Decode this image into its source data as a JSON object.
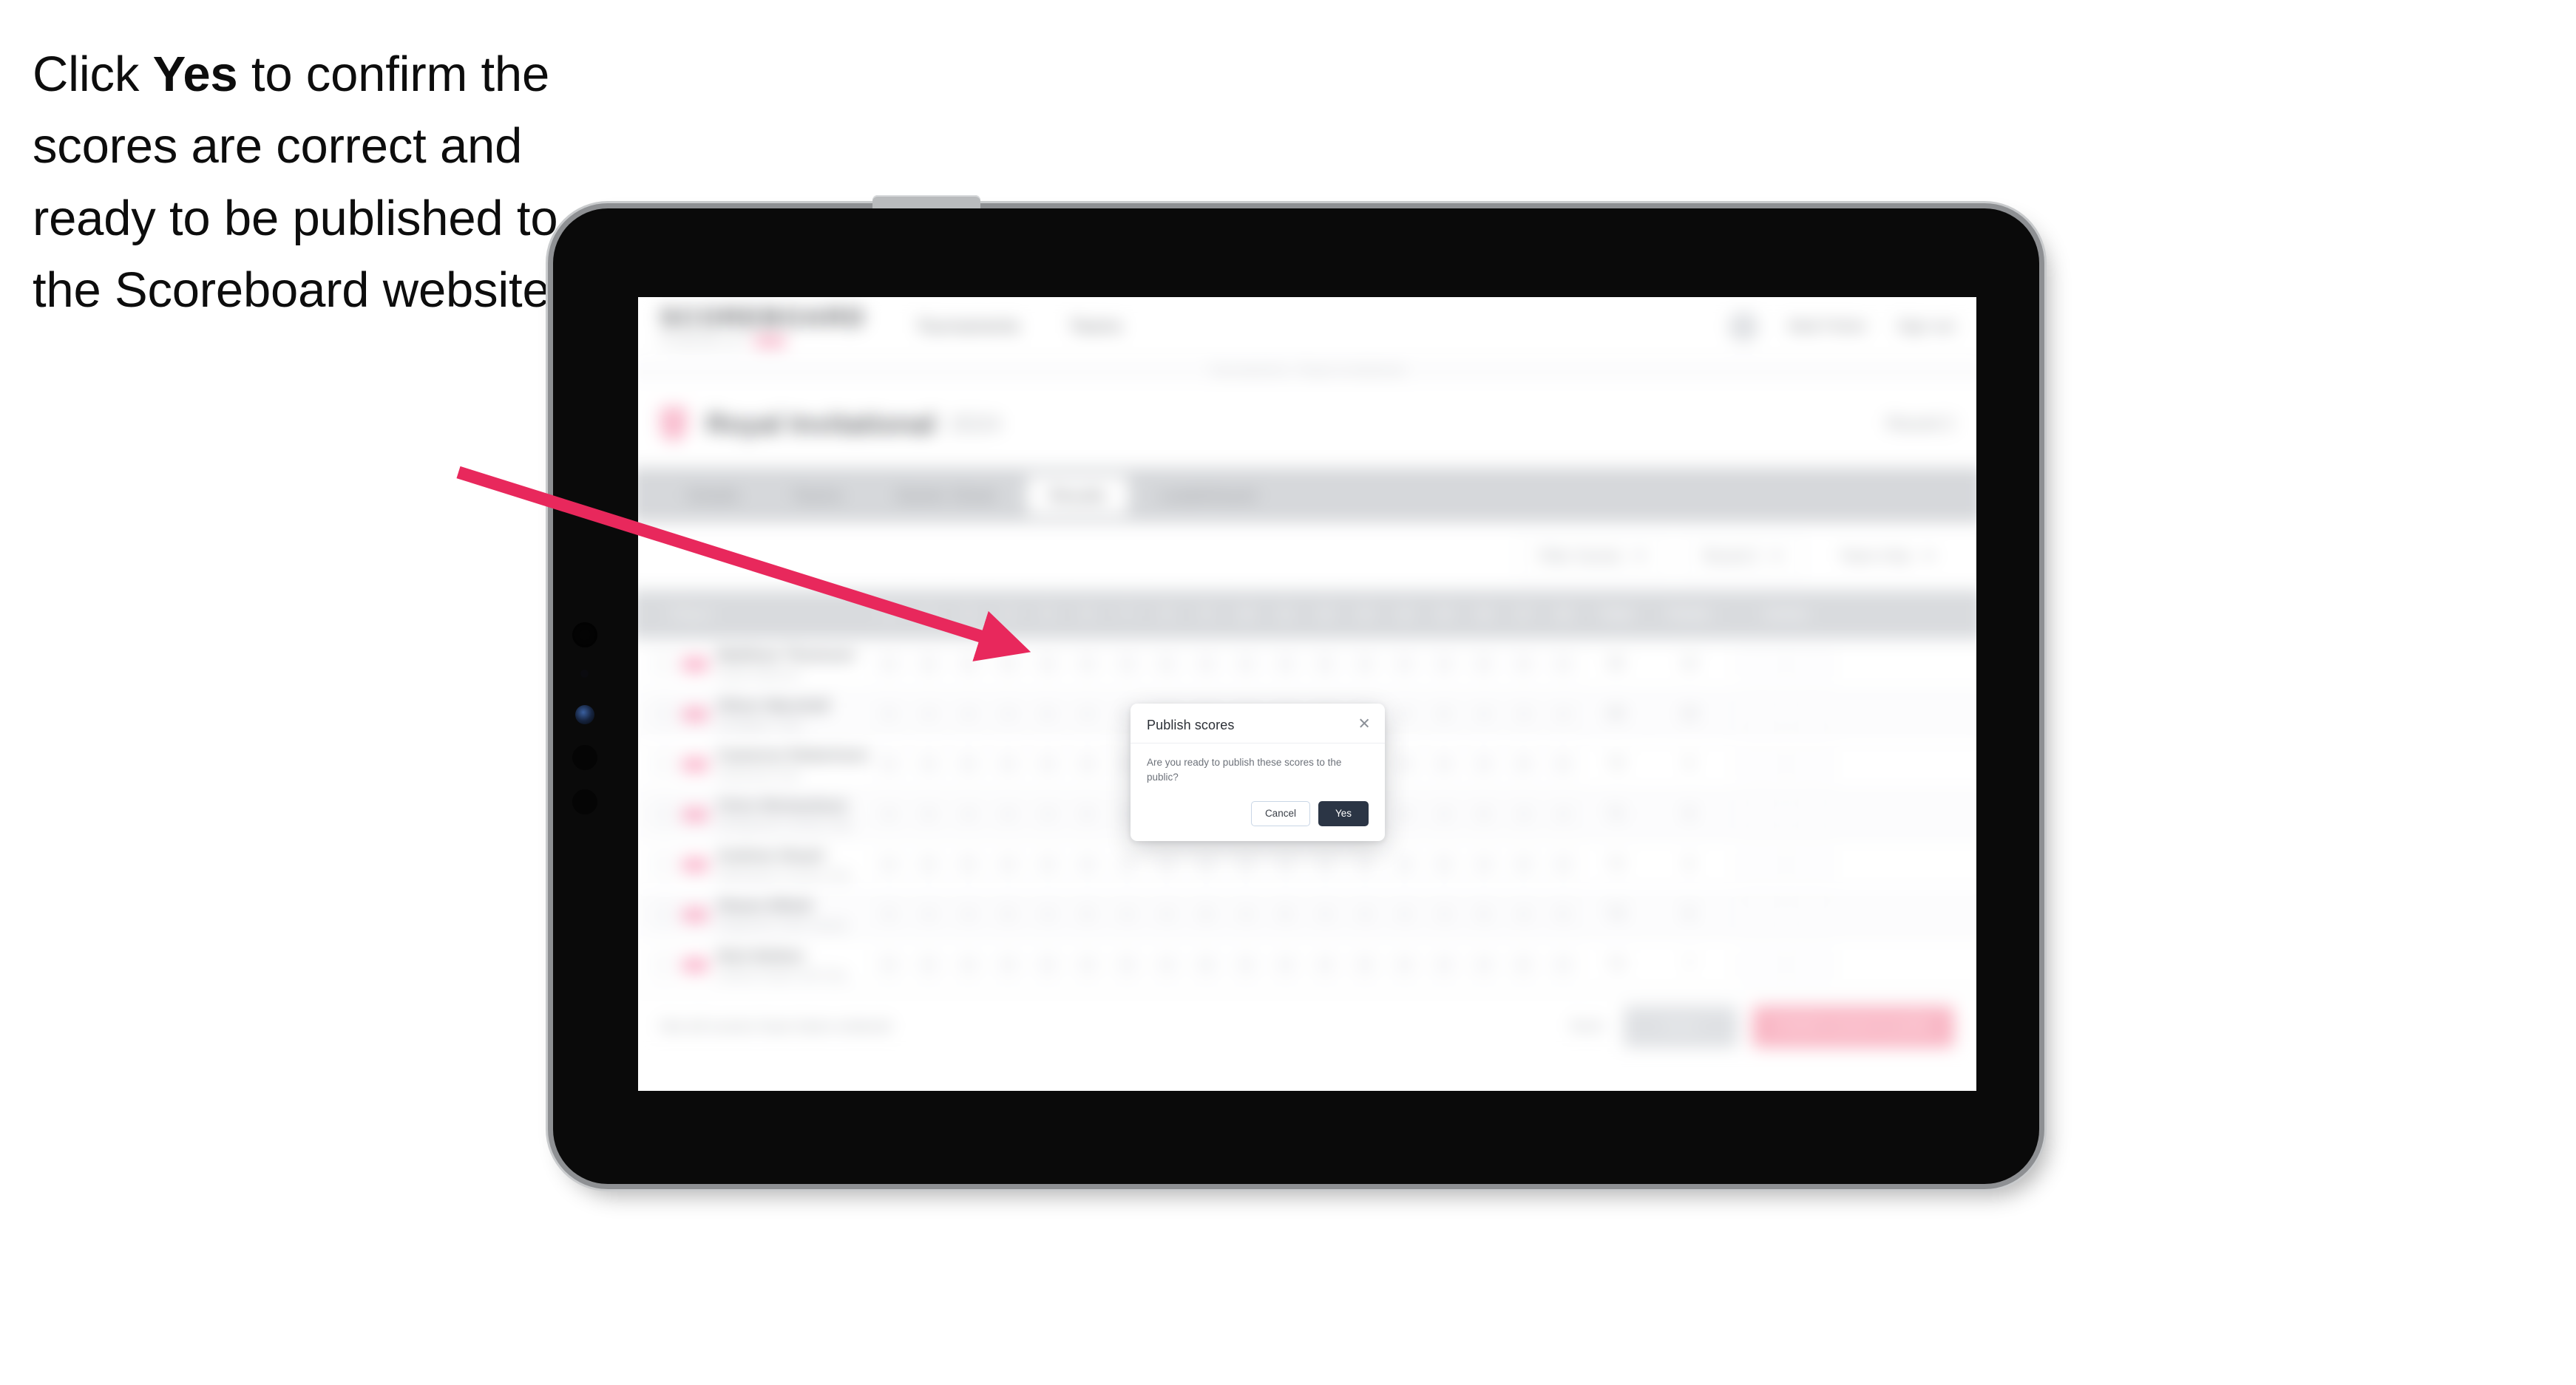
{
  "caption": {
    "before": "Click ",
    "bold": "Yes",
    "after": " to confirm the scores are correct and ready to be published to the Scoreboard website."
  },
  "colors": {
    "arrow": "#e8285c",
    "accent_pink": "#f9a7c2",
    "yes_button": "#2b3545",
    "tabbar": "#d6d8db",
    "table_header": "#d9dbde"
  },
  "device": {
    "type": "tablet",
    "orientation": "landscape"
  },
  "app": {
    "brand": {
      "name": "SCOREBOARD",
      "tagline": "POWERED BY"
    },
    "topnav": [
      {
        "label": "Tournaments"
      },
      {
        "label": "Teams"
      }
    ],
    "topbar_right": [
      {
        "label": "Matt Fisher"
      },
      {
        "label": "Sign out"
      }
    ],
    "breadcrumb": "Tournaments / Royal Invitational",
    "page_title": {
      "main": "Royal Invitational",
      "sub": "2024",
      "right": "Round 2"
    },
    "tabs": [
      {
        "label": "Details",
        "active": false
      },
      {
        "label": "Teams",
        "active": false
      },
      {
        "label": "Starter Sheet",
        "active": false
      },
      {
        "label": "Results",
        "active": true
      },
      {
        "label": "Leaderboard",
        "active": false
      }
    ],
    "toolbar": {
      "filters": [
        {
          "label": "Filter Scores"
        },
        {
          "label": "Round 2"
        },
        {
          "label": "Team Only"
        }
      ]
    },
    "table": {
      "headers": {
        "player": "Player",
        "holes": [
          "1",
          "2",
          "3",
          "4",
          "5",
          "6",
          "7",
          "8",
          "9",
          "10",
          "11",
          "12",
          "13",
          "14",
          "15",
          "16",
          "17",
          "18"
        ],
        "total": "Total",
        "points": "Points",
        "action": "Action"
      },
      "rows": [
        {
          "name": "Matthew Thomson",
          "club": "Royal Oakmont",
          "scores": [
            "4",
            "5",
            "3",
            "4",
            "5",
            "4",
            "3",
            "5",
            "4",
            "4",
            "3",
            "5",
            "4",
            "4",
            "3",
            "5",
            "4",
            "4"
          ],
          "total": "68",
          "points": "10",
          "actions": [
            "Edit",
            "View"
          ]
        },
        {
          "name": "Oliver Marshall",
          "club": "Sandpiper Links",
          "scores": [
            "5",
            "4",
            "4",
            "3",
            "5",
            "4",
            "4",
            "5",
            "3",
            "4",
            "4",
            "5",
            "3",
            "4",
            "5",
            "4",
            "3",
            "4"
          ],
          "total": "69",
          "points": "10",
          "actions": [
            "Edit",
            "View"
          ]
        },
        {
          "name": "Cameron Robertson",
          "club": "Glenbrook Park",
          "scores": [
            "4",
            "4",
            "5",
            "4",
            "4",
            "3",
            "5",
            "4",
            "4",
            "5",
            "4",
            "4",
            "3",
            "5",
            "4",
            "3",
            "4",
            "5"
          ],
          "total": "70",
          "points": "9",
          "actions": [
            "Edit",
            "View"
          ]
        },
        {
          "name": "Chris Richardson",
          "club": "Northpointe Country Club",
          "scores": [
            "5",
            "5",
            "4",
            "4",
            "3",
            "5",
            "4",
            "4",
            "6",
            "4",
            "3",
            "4",
            "5",
            "4",
            "4",
            "5",
            "3",
            "4"
          ],
          "total": "71",
          "points": "9",
          "actions": [
            "Edit",
            "View"
          ]
        },
        {
          "name": "Andrew Stuart",
          "club": "Willowbank Country Club",
          "scores": [
            "4",
            "5",
            "5",
            "4",
            "4",
            "4",
            "3",
            "5",
            "6",
            "5",
            "4",
            "4",
            "4",
            "3",
            "5",
            "4",
            "4",
            "4"
          ],
          "total": "72",
          "points": "8",
          "actions": [
            "Edit",
            "View"
          ]
        },
        {
          "name": "Shane Elliott",
          "club": "Kingsmere Links Course",
          "scores": [
            "5",
            "4",
            "4",
            "5",
            "4",
            "5",
            "4",
            "4",
            "6",
            "4",
            "5",
            "4",
            "4",
            "4",
            "3",
            "5",
            "4",
            "5"
          ],
          "total": "73",
          "points": "8",
          "actions": [
            "Edit",
            "View"
          ]
        },
        {
          "name": "Nick Bolton",
          "club": "Ashford Heath Golf Club",
          "scores": [
            "5",
            "5",
            "4",
            "4",
            "5",
            "4",
            "5",
            "4",
            "6",
            "5",
            "4",
            "4",
            "5",
            "4",
            "4",
            "4",
            "5",
            "4"
          ],
          "total": "74",
          "points": "7",
          "actions": [
            "Edit",
            "View"
          ]
        }
      ]
    },
    "footer": {
      "note": "Not all scores have been entered",
      "link": "Back",
      "save_label": "Save",
      "publish_label": "Publish scores to public"
    }
  },
  "modal": {
    "title": "Publish scores",
    "body": "Are you ready to publish these scores to the public?",
    "cancel_label": "Cancel",
    "yes_label": "Yes",
    "close_icon": "close-icon"
  }
}
